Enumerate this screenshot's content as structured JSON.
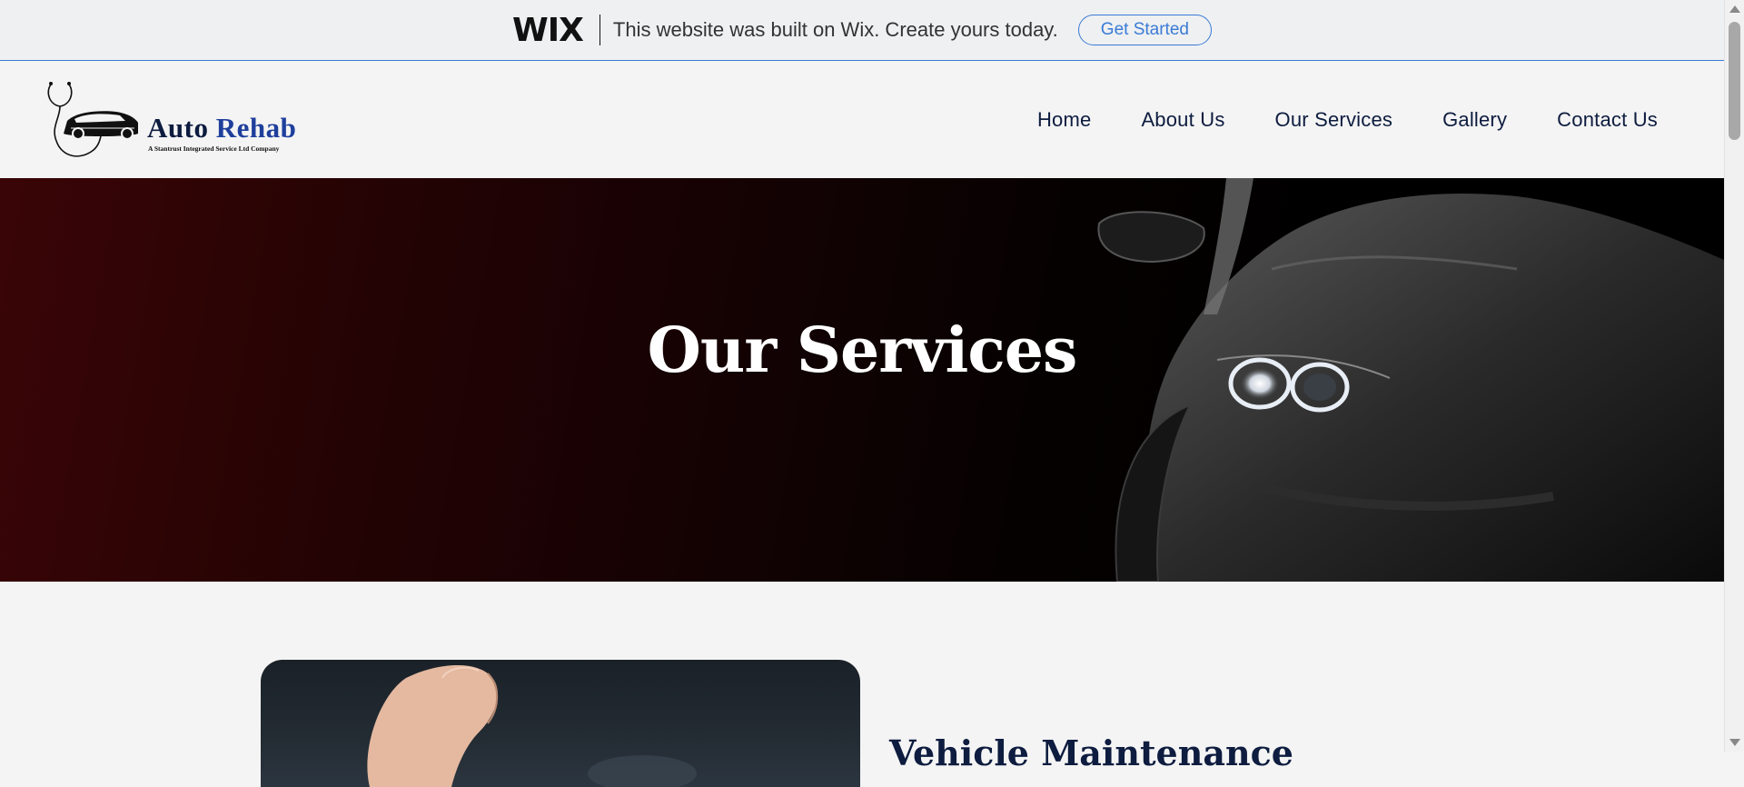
{
  "wix_banner": {
    "logo": "WIX",
    "message": "This website was built on Wix. Create yours today.",
    "cta_label": "Get Started",
    "accent_color": "#3a7bd5"
  },
  "header": {
    "logo_name_part1": "Auto ",
    "logo_name_part2": "Rehab",
    "logo_tagline": "A Stantrust Integrated Service Ltd Company",
    "nav": [
      "Home",
      "About Us",
      "Our Services",
      "Gallery",
      "Contact Us"
    ]
  },
  "hero": {
    "title": "Our Services"
  },
  "services": [
    {
      "title": "Vehicle Maintenance"
    }
  ],
  "colors": {
    "navy": "#0d1c3f",
    "hero_red": "#3a0506",
    "background": "#f4f4f4"
  }
}
